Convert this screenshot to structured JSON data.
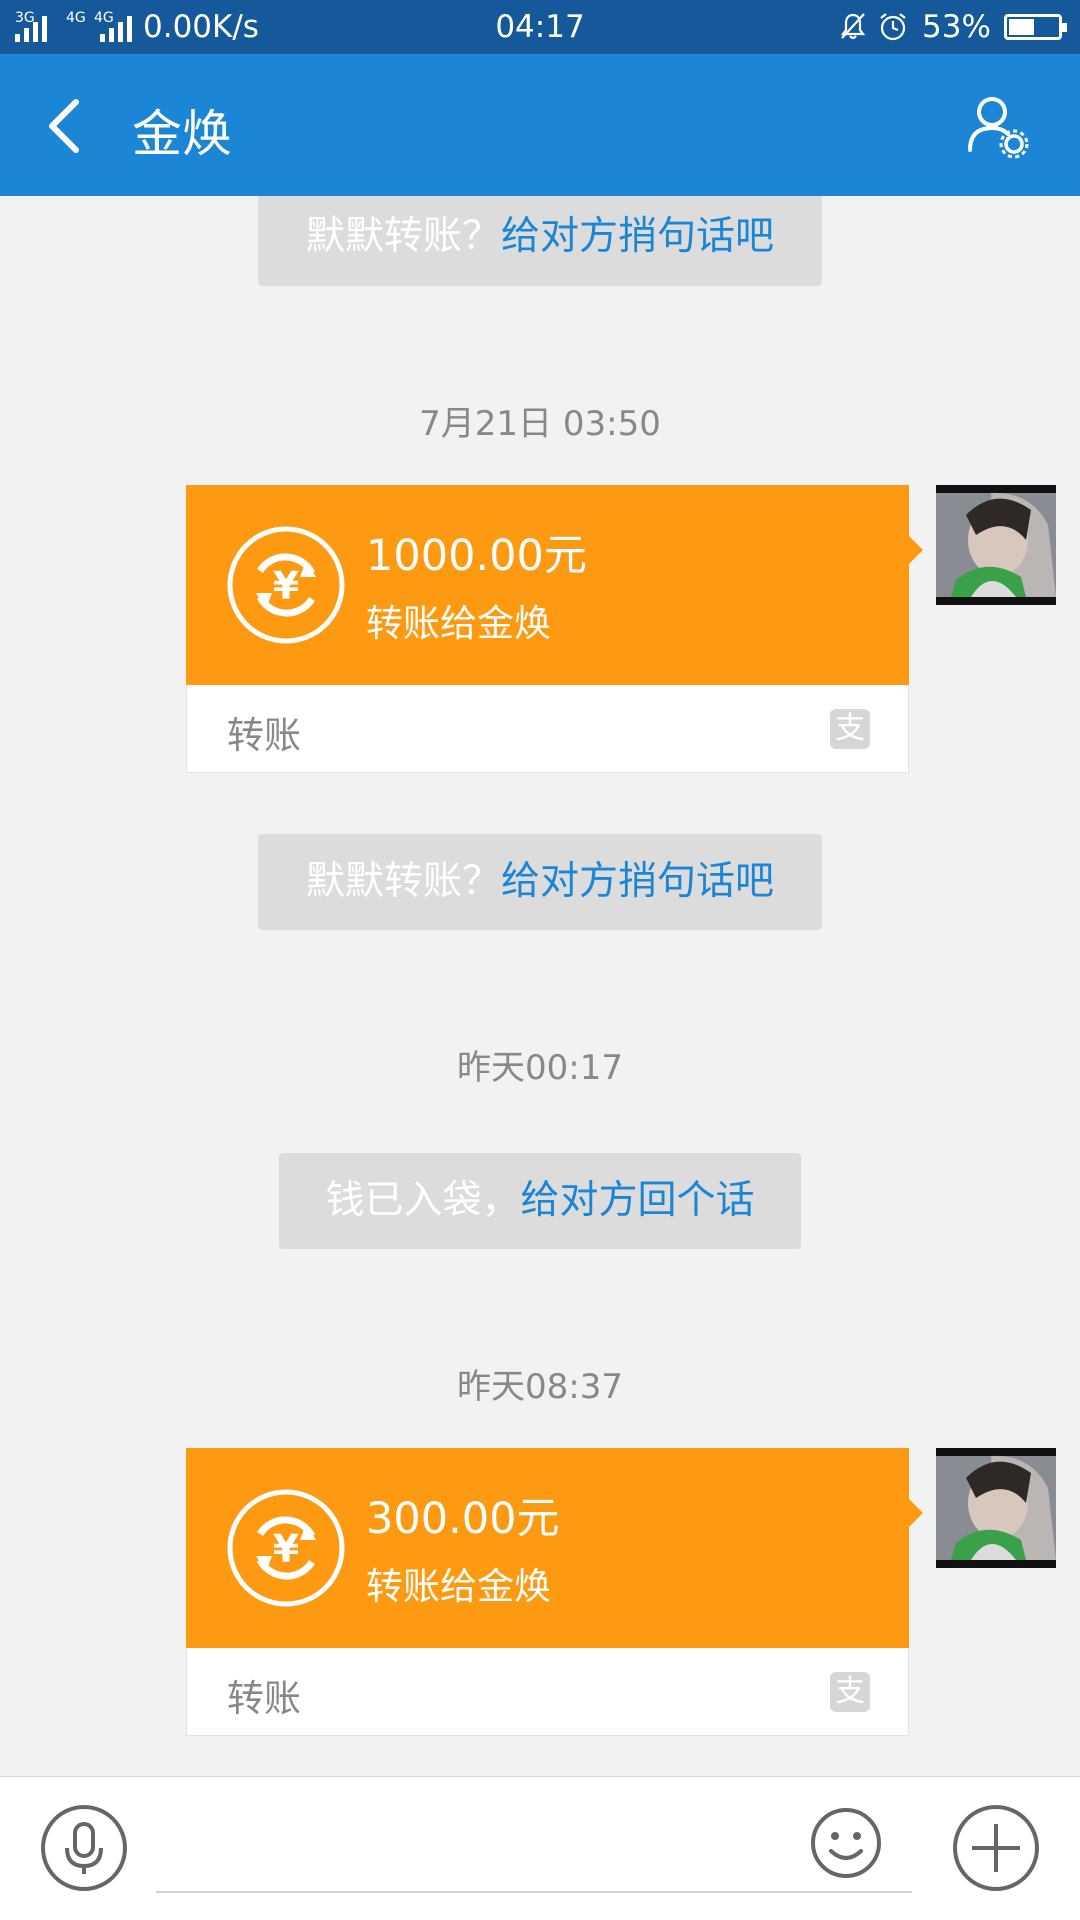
{
  "status_bar": {
    "sim1": "3G",
    "sim2": "4G",
    "sim3": "4G",
    "net_speed": "0.00K/s",
    "time": "04:17",
    "battery_percent": "53%",
    "battery_level": 0.53,
    "icons": [
      "signal-icon",
      "mute-bell-icon",
      "alarm-icon",
      "battery-icon"
    ]
  },
  "header": {
    "title": "金焕",
    "back_icon": "back-chevron-icon",
    "profile_icon": "profile-settings-icon"
  },
  "messages": {
    "hint1": {
      "grey": "默默转账？",
      "link": "给对方捎句话吧"
    },
    "ts1": "7月21日 03:50",
    "transfer1": {
      "amount": "1000.00元",
      "desc": "转账给金焕",
      "type": "转账",
      "logo": "支"
    },
    "hint2": {
      "grey": "默默转账？",
      "link": "给对方捎句话吧"
    },
    "ts2": "昨天00:17",
    "hint3": {
      "grey": "钱已入袋，",
      "link": "给对方回个话"
    },
    "ts3": "昨天08:37",
    "transfer2": {
      "amount": "300.00元",
      "desc": "转账给金焕",
      "type": "转账",
      "logo": "支"
    }
  },
  "input_bar": {
    "placeholder": "",
    "icons": [
      "microphone-icon",
      "emoji-icon",
      "plus-icon"
    ]
  },
  "colors": {
    "status_bar": "#16599a",
    "header": "#1c86d6",
    "transfer": "#fe9a11",
    "link": "#1c86d6"
  }
}
